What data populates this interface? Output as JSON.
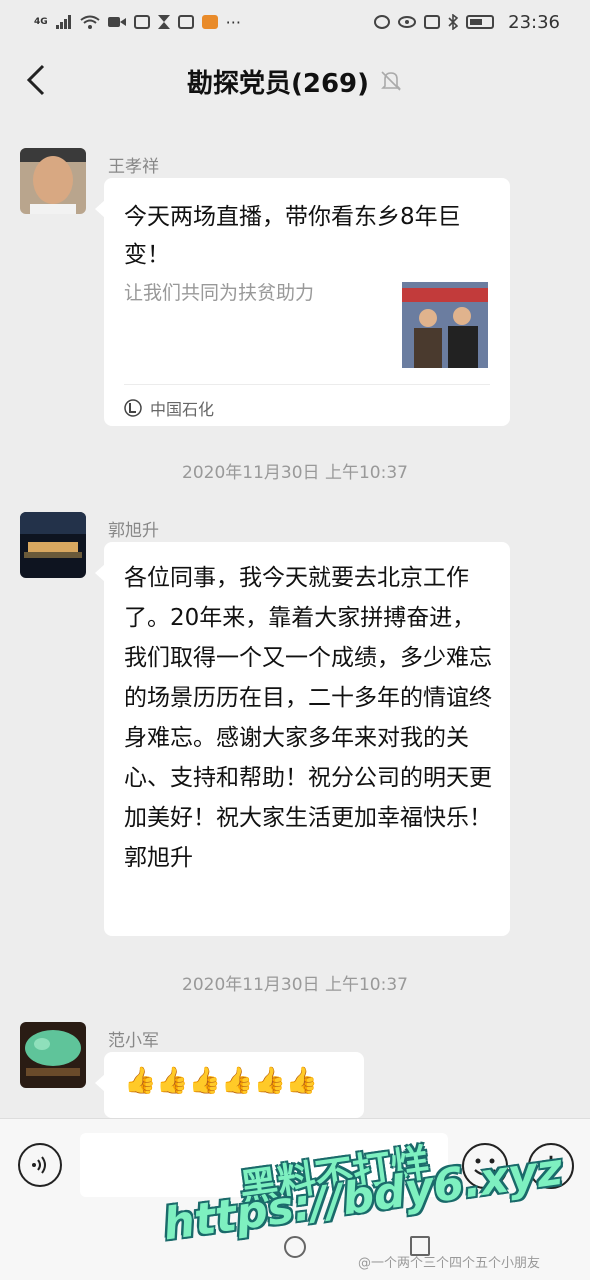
{
  "status_bar": {
    "network": "4G",
    "time": "23:36"
  },
  "nav": {
    "title": "勘探党员(269)"
  },
  "messages": [
    {
      "sender": "王孝祥",
      "type": "link_card",
      "card": {
        "title": "今天两场直播，带你看东乡8年巨变！",
        "description": "让我们共同为扶贫助力",
        "source": "中国石化"
      }
    },
    {
      "timestamp": "2020年11月30日 上午10:37"
    },
    {
      "sender": "郭旭升",
      "type": "text",
      "text": "各位同事，我今天就要去北京工作了。20年来，靠着大家拼搏奋进，我们取得一个又一个成绩，多少难忘的场景历历在目，二十多年的情谊终身难忘。感谢大家多年来对我的关心、支持和帮助！祝分公司的明天更加美好！祝大家生活更加幸福快乐！郭旭升"
    },
    {
      "timestamp": "2020年11月30日 上午10:37"
    },
    {
      "sender": "范小军",
      "type": "text",
      "text": "👍👍👍👍👍👍"
    }
  ],
  "input_bar": {
    "placeholder": "",
    "plus_label": "+"
  },
  "watermark": {
    "line1": "黑料不打烊",
    "line2": "https://bdy6.xyz",
    "weibo": "@一个两个三个四个五个小朋友"
  },
  "colors": {
    "background": "#ededed",
    "bubble": "#ffffff",
    "watermark": "#7ef0c0"
  }
}
